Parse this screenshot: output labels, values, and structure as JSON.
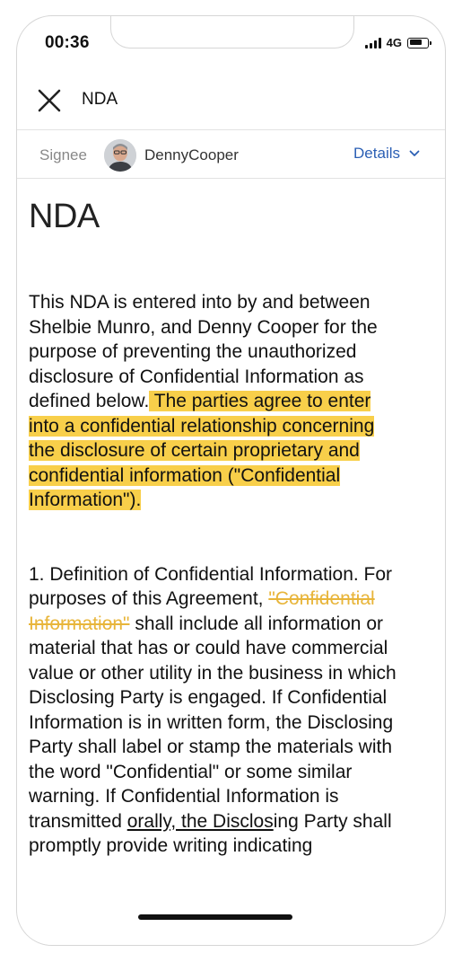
{
  "status_bar": {
    "time": "00:36",
    "network": "4G"
  },
  "header": {
    "title": "NDA",
    "close_icon": "close-icon"
  },
  "signee": {
    "label": "Signee",
    "name": "DennyCooper",
    "details_label": "Details",
    "details_icon": "chevron-down-icon"
  },
  "document": {
    "title": "NDA",
    "intro_plain": "This NDA is entered into by and between Shelbie Munro, and Denny Cooper for the purpose of preventing the unauthorized disclosure of Confidential Information as defined below.",
    "intro_highlighted": " The parties agree to enter into a confidential relationship concerning the disclosure of certain proprietary and confidential information (\"Confidential Information\").",
    "section1_a": "1. Definition of Confidential Information. For purposes of this Agreement, ",
    "section1_struck": "\"Confidential Information\"",
    "section1_b": " shall include all information or material that has or could have commercial value or other utility in the business in which Disclosing Party is engaged. If Confidential Information is in written form, the Disclosing Party shall label or stamp the materials with the word \"Confidential\" or some similar warning. If Confidential Information is transmitted ",
    "section1_underlined": "orally, the Disclos",
    "section1_c": "ing Party shall promptly provide writing indicating"
  },
  "colors": {
    "highlight": "#f8cf4a",
    "strike": "#e8b53a",
    "link": "#2b5fb4"
  }
}
